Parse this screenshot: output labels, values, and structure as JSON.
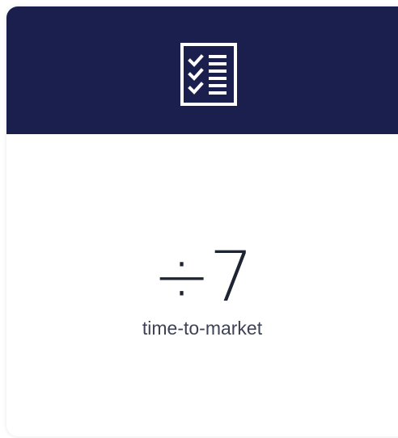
{
  "card": {
    "header_color": "#1b1f4e",
    "icon": "checklist-icon",
    "value": "÷7",
    "label": "time-to-market"
  }
}
